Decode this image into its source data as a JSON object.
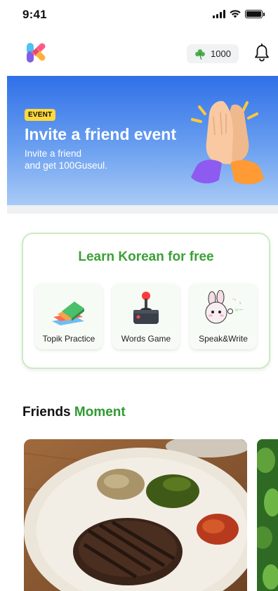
{
  "status_bar": {
    "time": "9:41",
    "icons": [
      "signal-icon",
      "wifi-icon",
      "battery-icon"
    ]
  },
  "header": {
    "logo_icon": "app-logo-icon",
    "points_icon": "clover-icon",
    "points": "1000",
    "notification_icon": "bell-icon"
  },
  "banner": {
    "badge": "EVENT",
    "title": "Invite a friend event",
    "subtitle_lines": [
      "Invite a friend",
      "and get 100Guseul."
    ],
    "illustration": "high-five-hands",
    "colors": {
      "top": "#2f70e8",
      "bottom": "#a9caf6",
      "badge": "#ffd93b"
    }
  },
  "learn": {
    "title": "Learn Korean for free",
    "accent_color": "#3aa135",
    "items": [
      {
        "label": "Topik Practice",
        "icon": "books-icon"
      },
      {
        "label": "Words Game",
        "icon": "joystick-icon"
      },
      {
        "label": "Speak&Write",
        "icon": "bunny-icon"
      }
    ]
  },
  "friends": {
    "title_part1": "Friends",
    "title_part2": "Moment",
    "accent_color": "#2f9a2f",
    "posts": [
      {
        "image": "steak-plate-photo"
      },
      {
        "image": "green-leaves-photo"
      }
    ]
  }
}
